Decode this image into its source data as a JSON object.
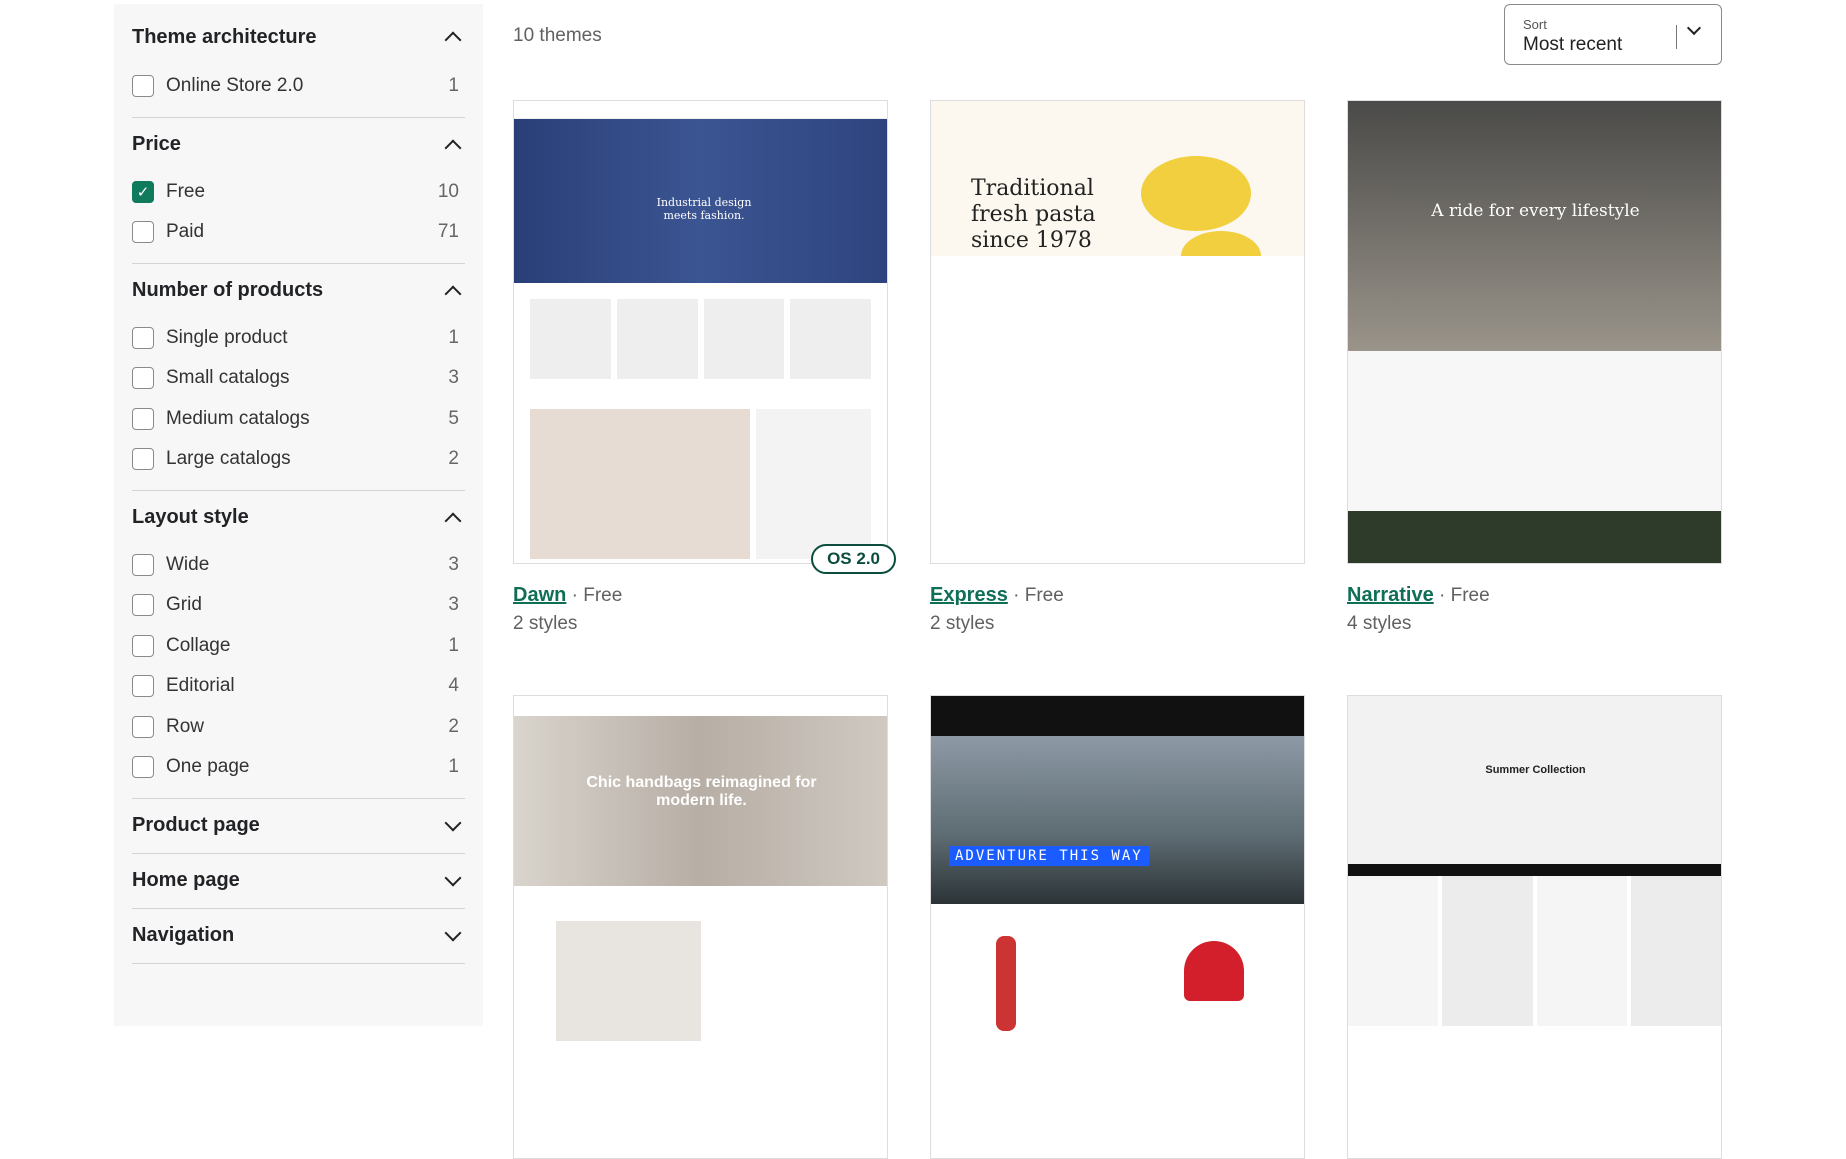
{
  "filters": [
    {
      "title": "Theme architecture",
      "expanded": true,
      "options": [
        {
          "label": "Online Store 2.0",
          "count": "1",
          "checked": false
        }
      ]
    },
    {
      "title": "Price",
      "expanded": true,
      "options": [
        {
          "label": "Free",
          "count": "10",
          "checked": true
        },
        {
          "label": "Paid",
          "count": "71",
          "checked": false
        }
      ]
    },
    {
      "title": "Number of products",
      "expanded": true,
      "options": [
        {
          "label": "Single product",
          "count": "1",
          "checked": false
        },
        {
          "label": "Small catalogs",
          "count": "3",
          "checked": false
        },
        {
          "label": "Medium catalogs",
          "count": "5",
          "checked": false
        },
        {
          "label": "Large catalogs",
          "count": "2",
          "checked": false
        }
      ]
    },
    {
      "title": "Layout style",
      "expanded": true,
      "options": [
        {
          "label": "Wide",
          "count": "3",
          "checked": false
        },
        {
          "label": "Grid",
          "count": "3",
          "checked": false
        },
        {
          "label": "Collage",
          "count": "1",
          "checked": false
        },
        {
          "label": "Editorial",
          "count": "4",
          "checked": false
        },
        {
          "label": "Row",
          "count": "2",
          "checked": false
        },
        {
          "label": "One page",
          "count": "1",
          "checked": false
        }
      ]
    },
    {
      "title": "Product page",
      "expanded": false,
      "options": []
    },
    {
      "title": "Home page",
      "expanded": false,
      "options": []
    },
    {
      "title": "Navigation",
      "expanded": false,
      "options": []
    }
  ],
  "results_count": "10 themes",
  "sort": {
    "label": "Sort",
    "value": "Most recent"
  },
  "accent": "#0f7a5c",
  "themes": [
    {
      "name": "Dawn",
      "price": "Free",
      "styles": "2 styles",
      "badge": "OS 2.0",
      "hero": "Industrial design meets fashion."
    },
    {
      "name": "Express",
      "price": "Free",
      "styles": "2 styles",
      "hero": "Traditional fresh pasta since 1978"
    },
    {
      "name": "Narrative",
      "price": "Free",
      "styles": "4 styles",
      "hero": "A ride for every lifestyle"
    },
    {
      "hero": "Chic handbags reimagined for modern life."
    },
    {
      "hero": "ADVENTURE THIS WAY"
    },
    {
      "hero": "Summer Collection"
    }
  ]
}
